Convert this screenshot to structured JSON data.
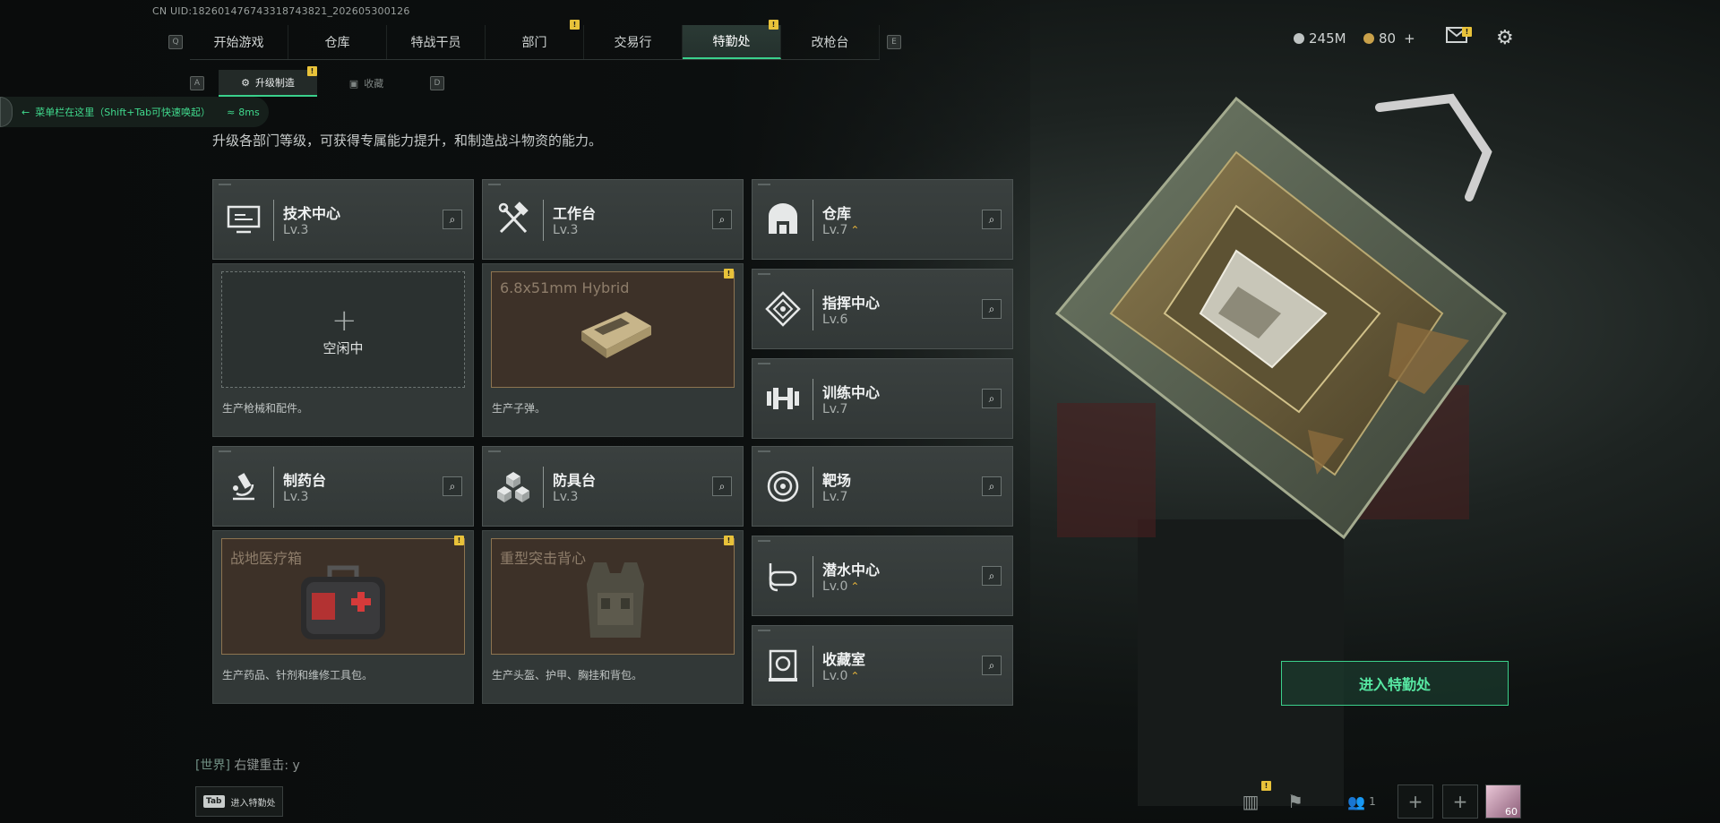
{
  "uid": "CN UID:1826014767433187438​21_202605300126",
  "nav": {
    "left_key": "Q",
    "right_key": "E",
    "tabs": [
      {
        "label": "开始游戏",
        "badge": ""
      },
      {
        "label": "仓库",
        "badge": ""
      },
      {
        "label": "特战干员",
        "badge": ""
      },
      {
        "label": "部门",
        "badge": "!"
      },
      {
        "label": "交易行",
        "badge": ""
      },
      {
        "label": "特勤处",
        "badge": "!",
        "active": true
      },
      {
        "label": "改枪台",
        "badge": ""
      }
    ]
  },
  "subnav": {
    "left_key": "A",
    "right_key": "D",
    "tabs": [
      {
        "label": "升级制造",
        "badge": "!",
        "active": true
      },
      {
        "label": "收藏"
      }
    ]
  },
  "hint": {
    "text": "菜单栏在这里（Shift+Tab可快速唤起）",
    "ping": "8ms"
  },
  "description": "升级各部门等级，可获得专属能力提升，和制造战斗物资的能力。",
  "departments": {
    "tech": {
      "title": "技术中心",
      "level": "Lv.3",
      "icon": "computer-icon"
    },
    "workbench": {
      "title": "工作台",
      "level": "Lv.3",
      "icon": "hammer-wrench-icon"
    },
    "pharmacy": {
      "title": "制药台",
      "level": "Lv.3",
      "icon": "microscope-icon"
    },
    "armor": {
      "title": "防具台",
      "level": "Lv.3",
      "icon": "cubes-icon"
    },
    "warehouse": {
      "title": "仓库",
      "level": "Lv.7",
      "icon": "warehouse-icon",
      "upgrade": "⌃"
    },
    "command": {
      "title": "指挥中心",
      "level": "Lv.6",
      "icon": "command-icon"
    },
    "training": {
      "title": "训练中心",
      "level": "Lv.7",
      "icon": "dumbbell-icon"
    },
    "range": {
      "title": "靶场",
      "level": "Lv.7",
      "icon": "target-icon"
    },
    "diving": {
      "title": "潜水中心",
      "level": "Lv.0",
      "icon": "diving-mask-icon",
      "upgrade": "⌃"
    },
    "collection": {
      "title": "收藏室",
      "level": "Lv.0",
      "icon": "collection-icon",
      "upgrade": "⌃"
    }
  },
  "production": {
    "tech": {
      "status": "空闲中",
      "caption": "生产枪械和配件。"
    },
    "workbench": {
      "item": "6.8x51mm Hybrid",
      "caption": "生产子弹。",
      "badge": "!"
    },
    "pharmacy": {
      "item": "战地医疗箱",
      "caption": "生产药品、针剂和维修工具包。",
      "badge": "!"
    },
    "armor": {
      "item": "重型突击背心",
      "caption": "生产头盔、护甲、胸挂和背包。",
      "badge": "!"
    }
  },
  "status": {
    "currency1": "245M",
    "currency2": "80",
    "plus": "+",
    "mail_badge": "!"
  },
  "enter_button": "进入特勤处",
  "chat": {
    "channel": "[世界]",
    "text": "右键重击: y"
  },
  "tab_hint": {
    "key": "Tab",
    "label": "进入特勤处"
  },
  "bottom": {
    "stats_badge": "!",
    "friends_count": "1",
    "avatar_level": "60"
  },
  "colors": {
    "accent": "#3ad08c",
    "badge": "#e8c23a",
    "upgrade": "#e6b43a"
  }
}
